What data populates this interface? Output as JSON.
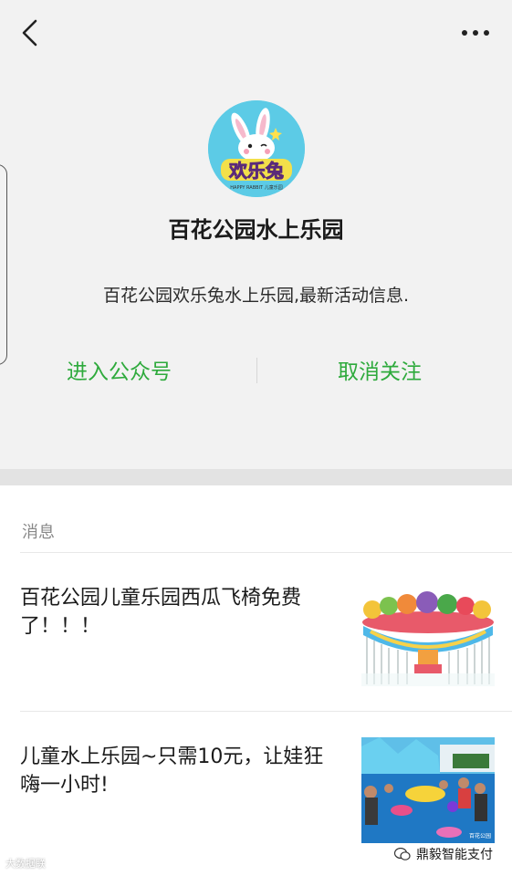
{
  "account": {
    "name": "百花公园水上乐园",
    "description": "百花公园欢乐兔水上乐园,最新活动信息.",
    "logo_text": "欢乐兔",
    "logo_subtext": "HAPPY RABBIT 儿童乐园"
  },
  "actions": {
    "enter_label": "进入公众号",
    "unfollow_label": "取消关注"
  },
  "messages": {
    "section_label": "消息",
    "items": [
      {
        "title": "百花公园儿童乐园西瓜飞椅免费了！！！"
      },
      {
        "title": "儿童水上乐园~只需10元，让娃狂嗨一小时!"
      }
    ]
  },
  "watermarks": {
    "left": "大数据联",
    "right": "鼎毅智能支付",
    "thumb": "百花公园"
  },
  "colors": {
    "accent_green": "#2eaa3c",
    "background": "#f2f2f2",
    "avatar_bg": "#5ccbe6"
  }
}
